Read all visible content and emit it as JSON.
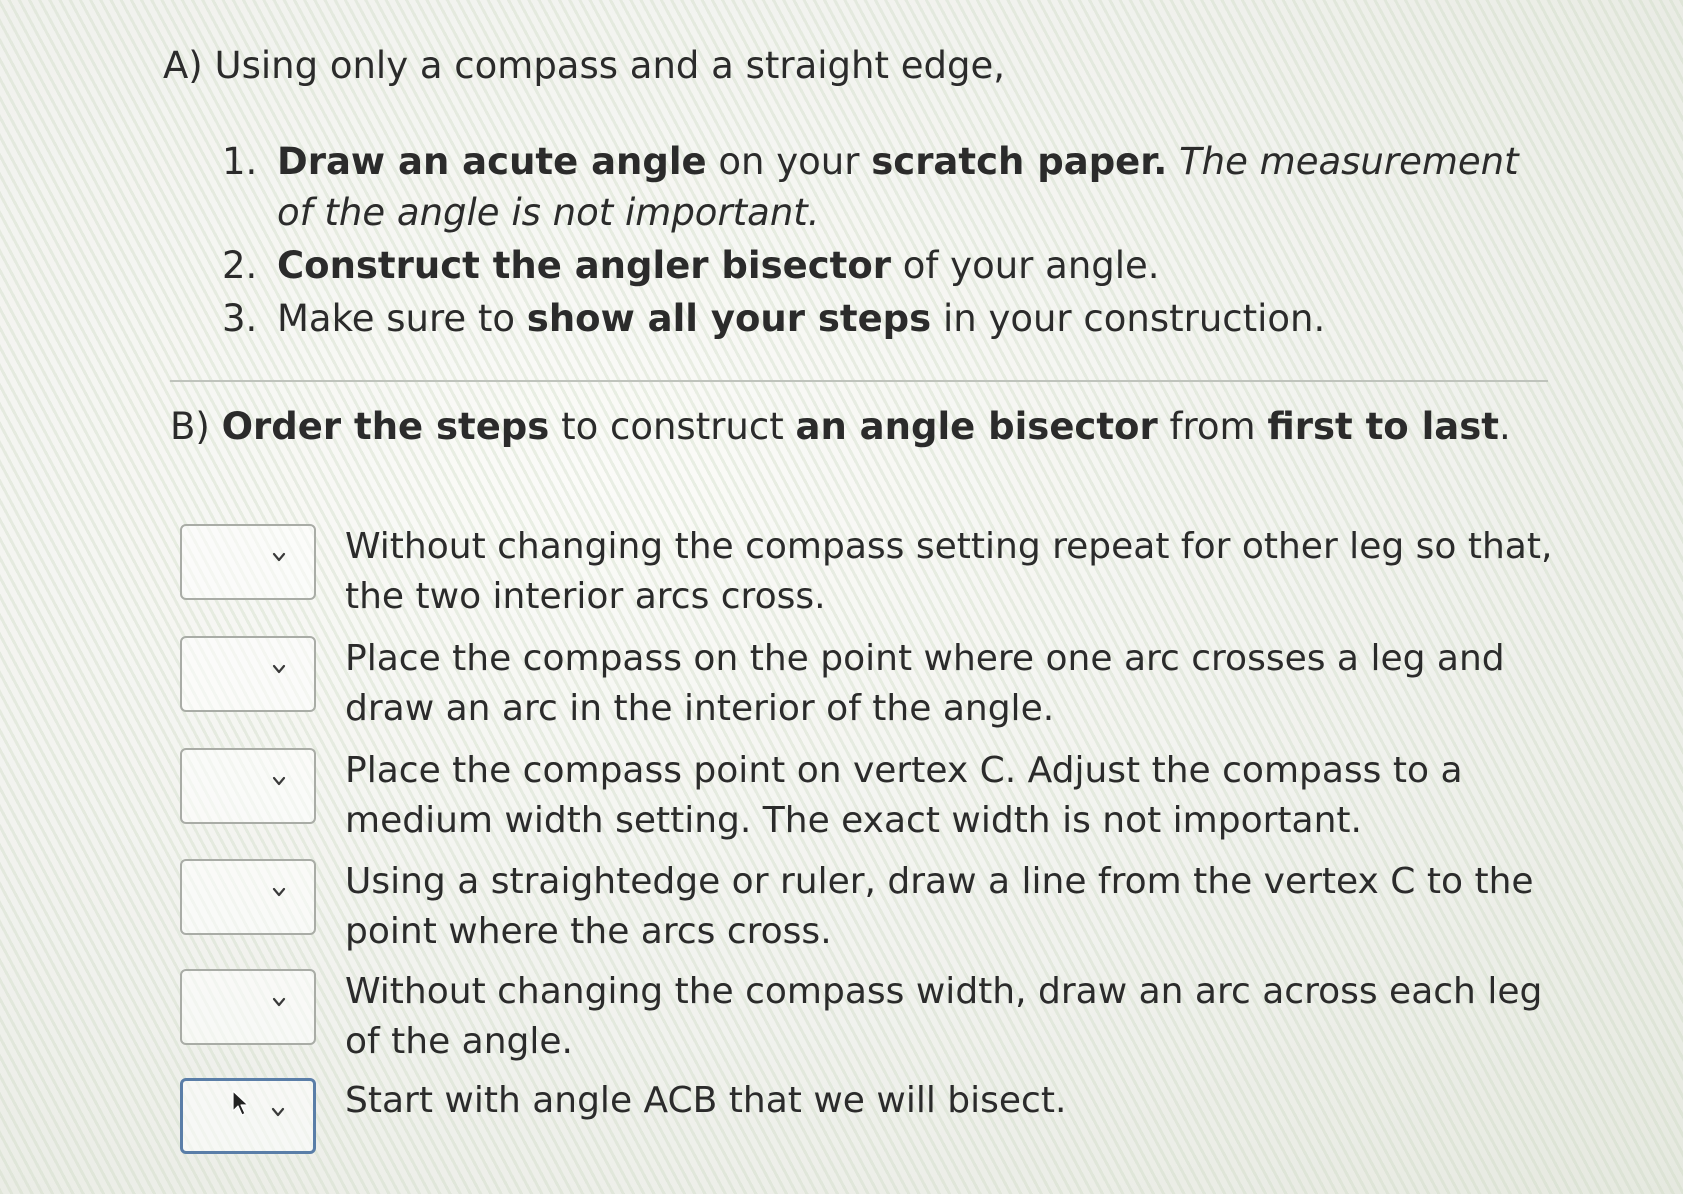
{
  "part_a": {
    "heading": "A) Using only a compass and a straight edge,",
    "items": [
      {
        "num": "1.",
        "bold1": "Draw an acute angle",
        "text1": " on your ",
        "bold2": "scratch paper.",
        "italic": " The measurement of the angle is not important."
      },
      {
        "num": "2.",
        "bold1": "Construct the angler bisector",
        "text1": " of your angle."
      },
      {
        "num": "3.",
        "text0": "Make sure to ",
        "bold1": "show all your steps",
        "text1": " in your construction."
      }
    ]
  },
  "part_b": {
    "prefix": "B) ",
    "bold1": "Order the steps",
    "text1": " to construct ",
    "bold2": "an angle bisector",
    "text2": " from ",
    "bold3": "first to last",
    "text3": "."
  },
  "steps": [
    {
      "selected": "",
      "text": "Without changing the compass setting repeat for other leg so that, the two interior arcs cross."
    },
    {
      "selected": "",
      "text": "Place the compass on the point where one arc crosses a leg and draw an arc in the interior of the angle."
    },
    {
      "selected": "",
      "text": "Place the compass point on vertex C. Adjust the compass to a medium width setting. The exact width is not important."
    },
    {
      "selected": "",
      "text": "Using a straightedge or ruler, draw a line from the vertex C to the point where the arcs cross."
    },
    {
      "selected": "",
      "text": "Without changing the compass width, draw an arc across each leg of the angle."
    },
    {
      "selected": "",
      "text": "Start with angle ACB that we will bisect."
    }
  ],
  "icons": {
    "dropdown": "chevron-down-icon",
    "pointer": "mouse-cursor-icon"
  },
  "colors": {
    "text": "#2b2b2b",
    "select_border": "#a9aca6",
    "focused_border": "#5a7ea8"
  }
}
